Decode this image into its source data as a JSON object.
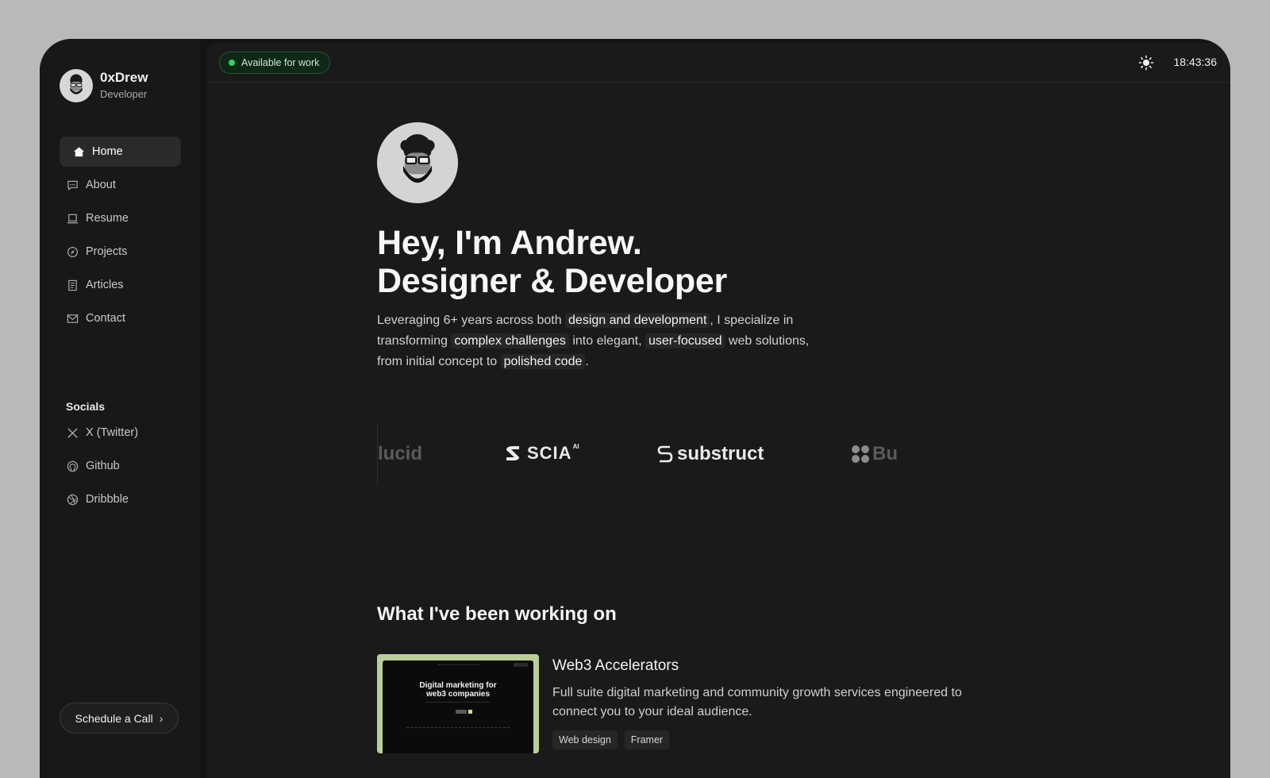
{
  "sidebar": {
    "profile": {
      "name": "0xDrew",
      "role": "Developer"
    },
    "nav": [
      {
        "label": "Home",
        "icon": "home-icon"
      },
      {
        "label": "About",
        "icon": "chat-icon"
      },
      {
        "label": "Resume",
        "icon": "laptop-icon"
      },
      {
        "label": "Projects",
        "icon": "compass-icon"
      },
      {
        "label": "Articles",
        "icon": "document-icon"
      },
      {
        "label": "Contact",
        "icon": "mail-icon"
      }
    ],
    "socials_title": "Socials",
    "socials": [
      {
        "label": "X (Twitter)",
        "icon": "x-icon"
      },
      {
        "label": "Github",
        "icon": "github-icon"
      },
      {
        "label": "Dribbble",
        "icon": "dribbble-icon"
      }
    ],
    "schedule_label": "Schedule a Call"
  },
  "topbar": {
    "status": "Available for work",
    "status_color": "#2fd160",
    "clock": "18:43:36"
  },
  "hero": {
    "line1": "Hey, I'm Andrew.",
    "line2": "Designer & Developer",
    "intro": {
      "t1": "Leveraging 6+ years across both ",
      "h1": "design and development",
      "t2": ", I specialize in transforming ",
      "h2": "complex challenges",
      "t3": " into elegant, ",
      "h3": "user-focused",
      "t4": " web solutions, from initial concept to ",
      "h4": "polished code",
      "t5": "."
    }
  },
  "logos": [
    "lucid",
    "SCIA",
    "AI",
    "substruct",
    "Bu"
  ],
  "work": {
    "title": "What I've been working on",
    "projects": [
      {
        "thumb_title": "Digital marketing for web3 companies",
        "title": "Web3 Accelerators",
        "description": "Full suite digital marketing and community growth services engineered to connect you to your ideal audience.",
        "tags": [
          "Web design",
          "Framer"
        ]
      }
    ]
  }
}
